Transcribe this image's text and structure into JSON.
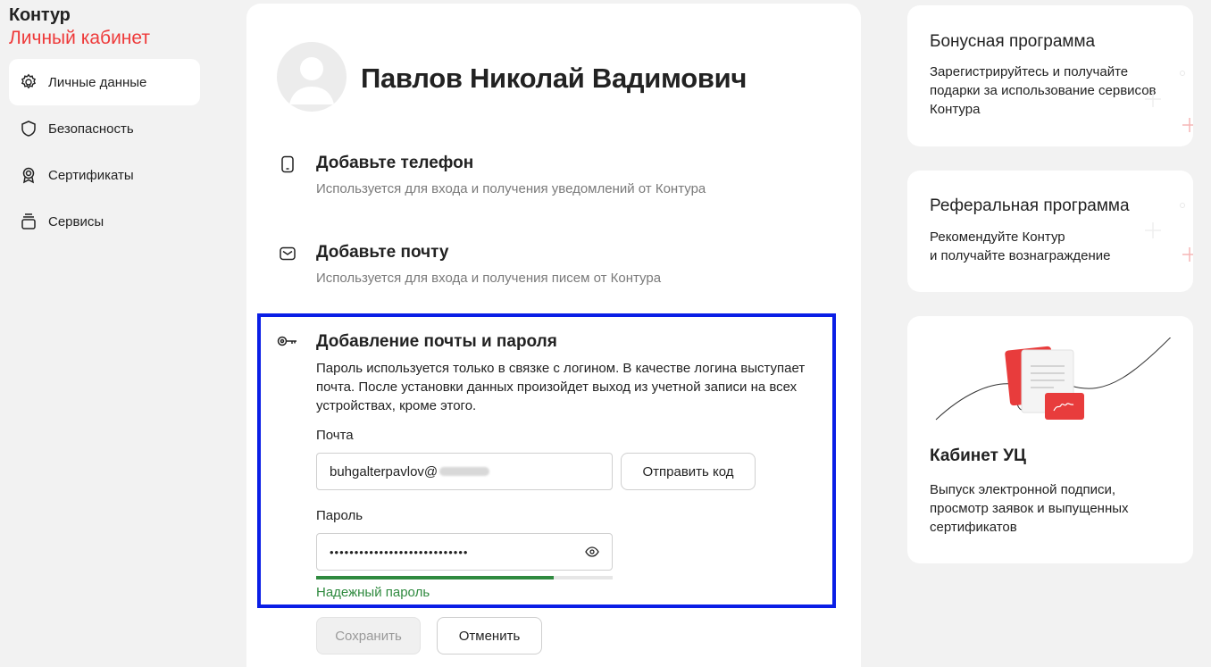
{
  "brand": {
    "name": "Контур",
    "subtitle": "Личный кабинет"
  },
  "sidebar": {
    "items": [
      {
        "label": "Личные данные",
        "icon": "gear-icon",
        "active": true
      },
      {
        "label": "Безопасность",
        "icon": "shield-icon",
        "active": false
      },
      {
        "label": "Сертификаты",
        "icon": "certificate-icon",
        "active": false
      },
      {
        "label": "Сервисы",
        "icon": "services-icon",
        "active": false
      }
    ]
  },
  "profile": {
    "full_name": "Павлов Николай Вадимович"
  },
  "phone_section": {
    "title": "Добавьте телефон",
    "description": "Используется для входа и получения уведомлений от Контура"
  },
  "email_section": {
    "title": "Добавьте почту",
    "description": "Используется для входа и получения писем от Контура"
  },
  "password_section": {
    "title": "Добавление почты и пароля",
    "description": "Пароль используется только в связке с логином. В качестве логина выступает почта. После установки данных произойдет выход из учетной записи на всех устройствах, кроме этого.",
    "email_label": "Почта",
    "email_value": "buhgalterpavlov@",
    "send_code_label": "Отправить код",
    "password_label": "Пароль",
    "password_value": "••••••••••••••••••••••••••••",
    "strength_fraction": 0.8,
    "strength_text": "Надежный пароль",
    "save_label": "Сохранить",
    "cancel_label": "Отменить"
  },
  "cards": {
    "bonus": {
      "title": "Бонусная программа",
      "text": "Зарегистрируйтесь и получайте подарки за использование сервисов Контура"
    },
    "referral": {
      "title": "Реферальная программа",
      "text_line1": "Рекомендуйте Контур",
      "text_line2": "и получайте вознаграждение"
    },
    "uc": {
      "title": "Кабинет УЦ",
      "text": "Выпуск электронной подписи, просмотр заявок и выпущенных сертификатов"
    }
  },
  "colors": {
    "accent": "#ee3a3a",
    "focus_border": "#0a1ee6",
    "strength": "#2f8a3f"
  }
}
